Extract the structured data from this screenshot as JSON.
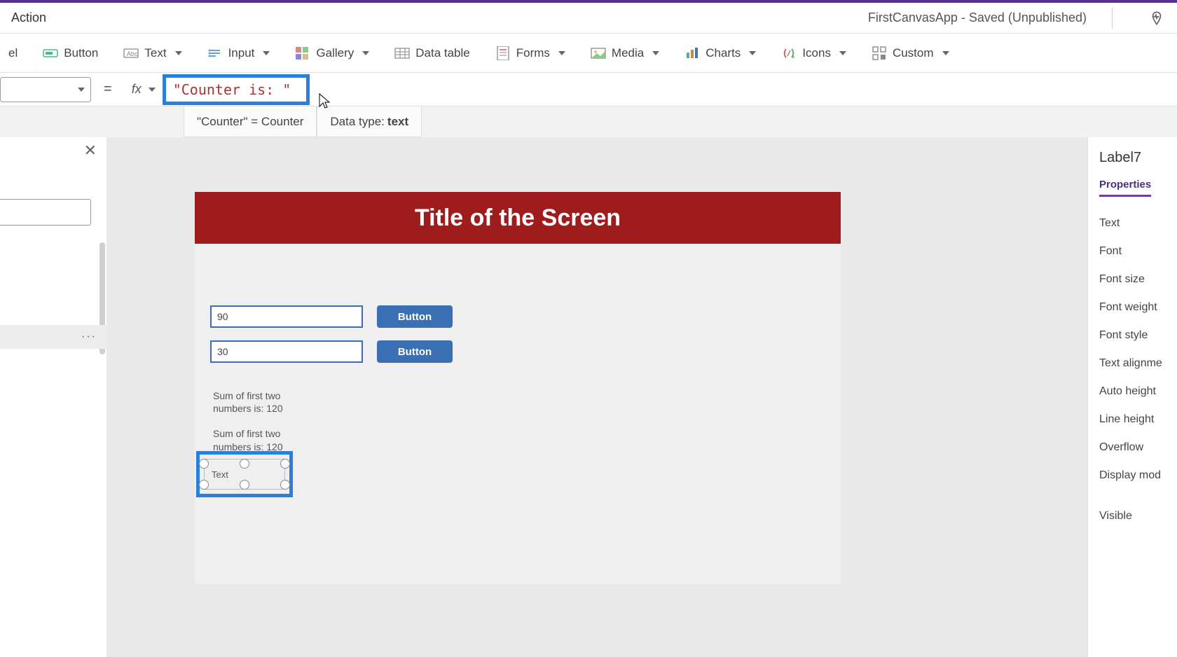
{
  "app": {
    "title": "FirstCanvasApp - Saved (Unpublished)",
    "menu": "Action"
  },
  "ribbon": {
    "label_partial": "el",
    "button": "Button",
    "text": "Text",
    "input": "Input",
    "gallery": "Gallery",
    "datatable": "Data table",
    "forms": "Forms",
    "media": "Media",
    "charts": "Charts",
    "icons": "Icons",
    "custom": "Custom"
  },
  "formula": {
    "fx": "fx",
    "expression_display": "\"Counter is: \"",
    "suggestion": "\"Counter\"  =  Counter",
    "datatype_label": "Data type: ",
    "datatype_value": "text"
  },
  "tree": {
    "more": "···"
  },
  "canvas": {
    "screen_title": "Title of the Screen",
    "input1_value": "90",
    "input2_value": "30",
    "button_label": "Button",
    "sum_label_1": "Sum of first two numbers is: 120",
    "sum_label_2": "Sum of first two numbers is: 120",
    "selected_text": "Text"
  },
  "properties": {
    "object": "Label7",
    "tab": "Properties",
    "rows": [
      "Text",
      "Font",
      "Font size",
      "Font weight",
      "Font style",
      "Text alignme",
      "Auto height",
      "Line height",
      "Overflow",
      "Display mod",
      "Visible"
    ]
  }
}
